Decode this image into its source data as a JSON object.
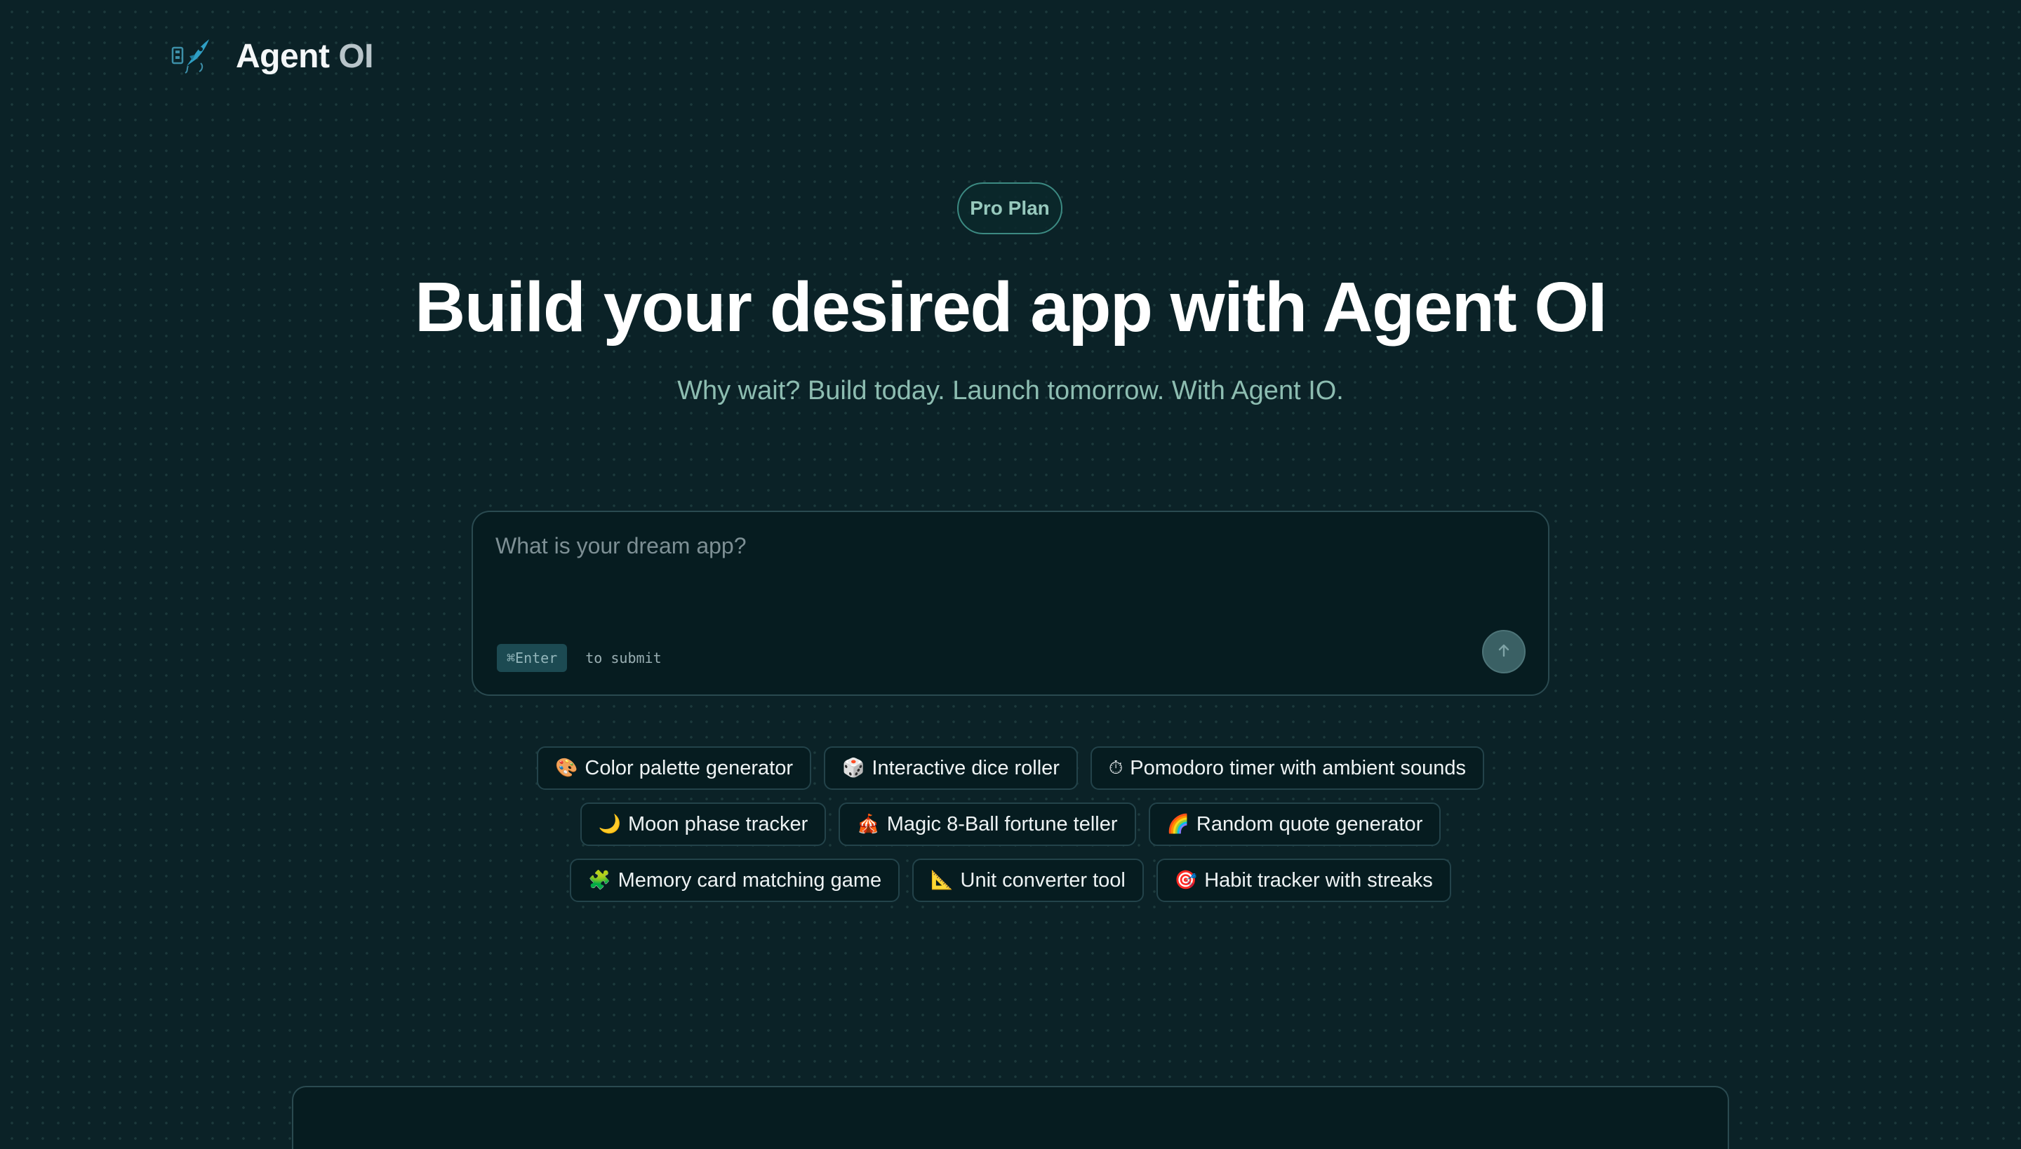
{
  "header": {
    "brand_primary": "Agent",
    "brand_accent": "OI",
    "logo_icon": "rocket-icon"
  },
  "hero": {
    "badge": "Pro Plan",
    "title": "Build your desired app with Agent OI",
    "subtitle": "Why wait? Build today. Launch tomorrow. With Agent IO."
  },
  "prompt": {
    "placeholder": "What is your dream app?",
    "value": "",
    "shortcut_key": "⌘Enter",
    "shortcut_hint": "to submit",
    "submit_icon": "arrow-up-icon"
  },
  "suggestions": [
    [
      {
        "emoji": "🎨",
        "label": "Color palette generator"
      },
      {
        "emoji": "🎲",
        "label": "Interactive dice roller"
      },
      {
        "emoji": "⏱",
        "label": "Pomodoro timer with ambient sounds"
      }
    ],
    [
      {
        "emoji": "🌙",
        "label": "Moon phase tracker"
      },
      {
        "emoji": "🎪",
        "label": "Magic 8-Ball fortune teller"
      },
      {
        "emoji": "🌈",
        "label": "Random quote generator"
      }
    ],
    [
      {
        "emoji": "🧩",
        "label": "Memory card matching game"
      },
      {
        "emoji": "📐",
        "label": "Unit converter tool"
      },
      {
        "emoji": "🎯",
        "label": "Habit tracker with streaks"
      }
    ]
  ],
  "colors": {
    "background": "#0b2227",
    "accent": "#97c9bd",
    "subtitle": "#8dbdb1"
  }
}
